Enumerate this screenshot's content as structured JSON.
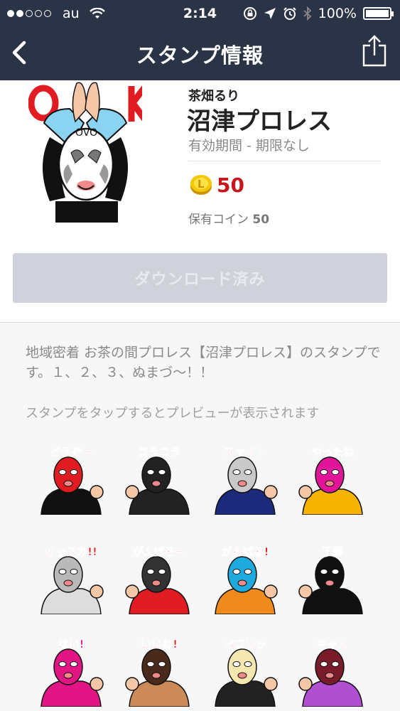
{
  "status": {
    "carrier": "au",
    "time": "2:14",
    "battery": "100%"
  },
  "nav": {
    "title": "スタンプ情報"
  },
  "product": {
    "author": "茶畑るり",
    "name": "沼津プロレス",
    "validity": "有効期間 - 期限なし",
    "price": "50",
    "owned_label": "保有コイン",
    "owned_value": "50",
    "download_button": "ダウンロード済み",
    "thumbnail_text": "OK"
  },
  "description": "地域密着 お茶の間プロレス【沼津プロレス】のスタンプです。１、２、３、ぬまづ〜！！",
  "hint": "スタンプをタップするとプレビューが表示されます",
  "stickers": [
    {
      "text": "どうぞー",
      "mask": "#e11b22",
      "body": "#111111"
    },
    {
      "text": "コラコラ",
      "mask": "#222222",
      "body": "#222222"
    },
    {
      "text": "ファイト",
      "mask": "#c9c9c9",
      "body": "#1b2a7a"
    },
    {
      "text": "やったね",
      "mask": "#e2159a",
      "body": "#f6b400"
    },
    {
      "text": "イッスカ!!",
      "mask": "#b9b9b9",
      "body": "#dddddd"
    },
    {
      "text": "がんばろー",
      "mask": "#333333",
      "body": "#e11b22"
    },
    {
      "text": "がんばる!",
      "mask": "#1eaadc",
      "body": "#f08a1c"
    },
    {
      "text": "了解",
      "mask": "#111111",
      "body": "#111111"
    },
    {
      "text": "はい!",
      "mask": "#e21585",
      "body": "#e21585"
    },
    {
      "text": "いいね!",
      "mask": "#4a2a1a",
      "body": "#cc8a58"
    },
    {
      "text": "ペコリッ",
      "mask": "#f4e7b0",
      "body": "#222222"
    },
    {
      "text": "キャハ",
      "mask": "#7a1b2a",
      "body": "#b04fcf"
    }
  ]
}
